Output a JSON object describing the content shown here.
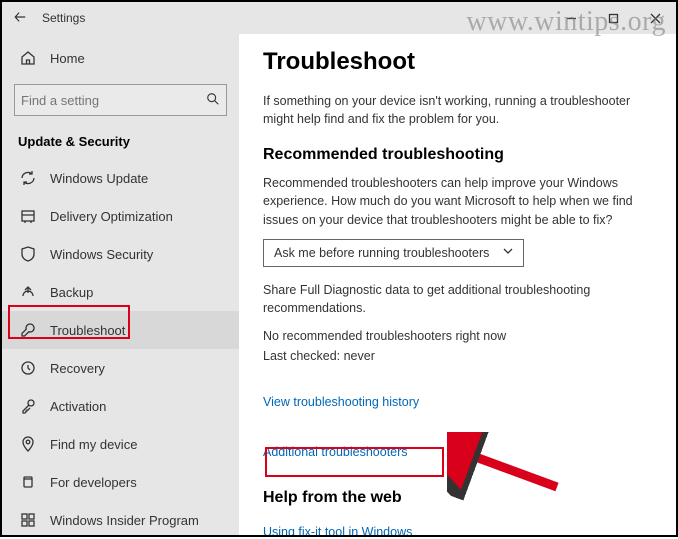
{
  "watermark": "www.wintips.org",
  "titlebar": {
    "title": "Settings"
  },
  "sidebar": {
    "home": "Home",
    "search_placeholder": "Find a setting",
    "section": "Update & Security",
    "items": [
      {
        "icon": "sync-icon",
        "label": "Windows Update"
      },
      {
        "icon": "delivery-icon",
        "label": "Delivery Optimization"
      },
      {
        "icon": "shield-icon",
        "label": "Windows Security"
      },
      {
        "icon": "backup-icon",
        "label": "Backup"
      },
      {
        "icon": "wrench-icon",
        "label": "Troubleshoot",
        "active": true
      },
      {
        "icon": "recovery-icon",
        "label": "Recovery"
      },
      {
        "icon": "key-icon",
        "label": "Activation"
      },
      {
        "icon": "location-icon",
        "label": "Find my device"
      },
      {
        "icon": "devs-icon",
        "label": "For developers"
      },
      {
        "icon": "insider-icon",
        "label": "Windows Insider Program"
      }
    ]
  },
  "content": {
    "heading": "Troubleshoot",
    "intro": "If something on your device isn't working, running a troubleshooter might help find and fix the problem for you.",
    "rec_heading": "Recommended troubleshooting",
    "rec_desc": "Recommended troubleshooters can help improve your Windows experience. How much do you want Microsoft to help when we find issues on your device that troubleshooters might be able to fix?",
    "dropdown_value": "Ask me before running troubleshooters",
    "warning": "Share Full Diagnostic data to get additional troubleshooting recommendations.",
    "no_rec": "No recommended troubleshooters right now",
    "last_checked": "Last checked: never",
    "history_link": "View troubleshooting history",
    "additional_link": "Additional troubleshooters",
    "help_heading": "Help from the web",
    "fixit_link": "Using fix-it tool in Windows"
  }
}
